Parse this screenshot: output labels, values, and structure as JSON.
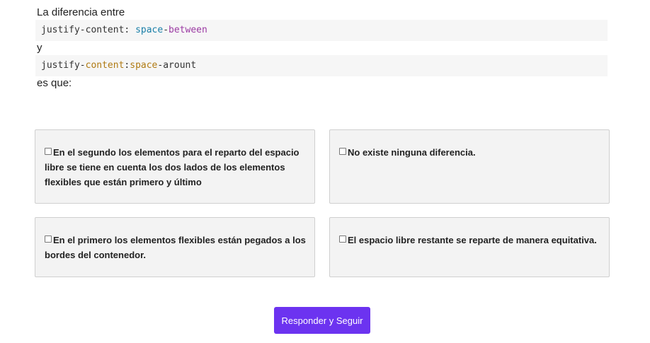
{
  "question": {
    "line1": "La diferencia entre",
    "code1": {
      "prop": "justify-content:",
      "val_a": "space",
      "val_sep": "-",
      "val_b": "between"
    },
    "line2": "y",
    "code2": {
      "prop_a": "justify-",
      "prop_b": "content",
      "colon": ":",
      "val_a": "space",
      "val_b": "-arount"
    },
    "line3": "es que:"
  },
  "options": [
    {
      "label": "En el segundo los elementos para el reparto del espacio libre se tiene en cuenta los dos lados de los elementos flexibles que están primero y último",
      "checked": false
    },
    {
      "label": "No existe ninguna diferencia.",
      "checked": false
    },
    {
      "label": "En el primero los elementos flexibles están pegados a los bordes del contenedor.",
      "checked": false
    },
    {
      "label": "El espacio libre restante se reparte de manera equitativa.",
      "checked": false
    }
  ],
  "submit_label": "Responder y Seguir",
  "colors": {
    "accent": "#6c33f0",
    "option_bg": "#f3f3f3",
    "code_bg": "#f6f6f6"
  }
}
